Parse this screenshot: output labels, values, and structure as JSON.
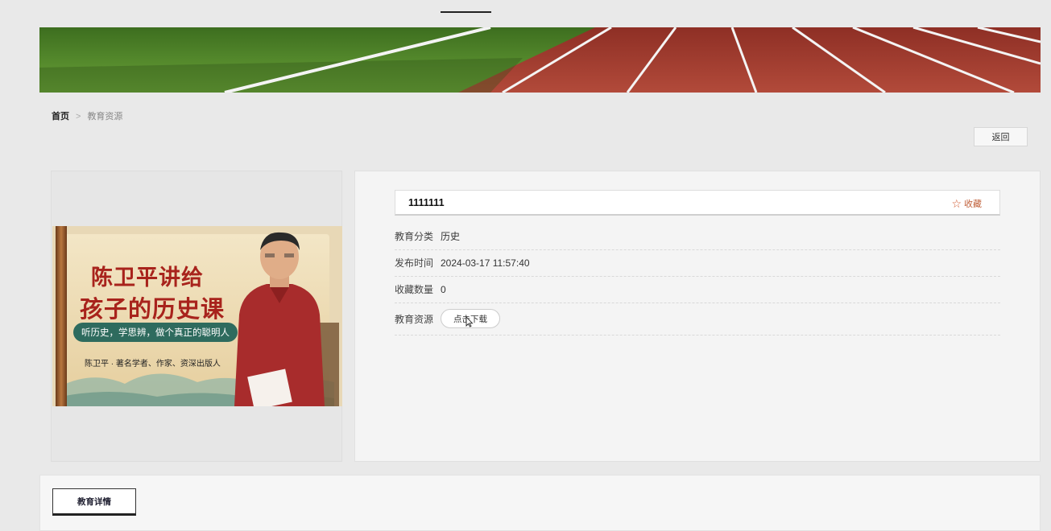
{
  "breadcrumb": {
    "home": "首页",
    "separator": ">",
    "current": "教育资源"
  },
  "back_button": "返回",
  "poster": {
    "title_line1": "陈卫平讲给",
    "title_line2": "孩子的历史课",
    "tagline": "听历史，学思辨，做个真正的聪明人",
    "author": "陈卫平 · 著名学者、作家、资深出版人"
  },
  "resource": {
    "title": "1111111",
    "favorite_label": "收藏",
    "fields": [
      {
        "label": "教育分类",
        "value": "历史"
      },
      {
        "label": "发布时间",
        "value": "2024-03-17 11:57:40"
      },
      {
        "label": "收藏数量",
        "value": "0"
      }
    ],
    "download": {
      "label": "教育资源",
      "button": "点击下载"
    }
  },
  "detail_tab": "教育详情",
  "colors": {
    "accent": "#d0552a",
    "track": "#a33a2e",
    "grass": "#4e8a2a"
  },
  "icons": {
    "favorite": "star-outline-icon"
  }
}
